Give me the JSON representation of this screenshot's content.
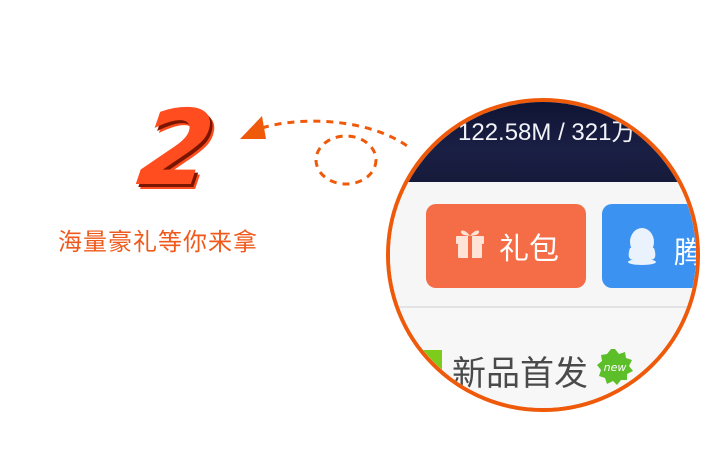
{
  "step": {
    "number": "2",
    "caption": "海量豪礼等你来拿"
  },
  "zoom": {
    "topbar_text": "122.58M / 321万",
    "gift_button_label": "礼包",
    "tencent_button_label": "腾",
    "section_title": "新品首发",
    "new_badge": "new"
  },
  "icons": [
    "gift-icon",
    "qq-penguin-icon",
    "new-badge-icon",
    "arrow-head-icon"
  ],
  "colors": {
    "accent_orange": "#ef5a0a",
    "gift_button": "#f46d46",
    "tencent_button": "#3c92f0",
    "topbar": "#141836",
    "section_marker": "#7dcc1c",
    "new_badge": "#5cbf2a"
  }
}
